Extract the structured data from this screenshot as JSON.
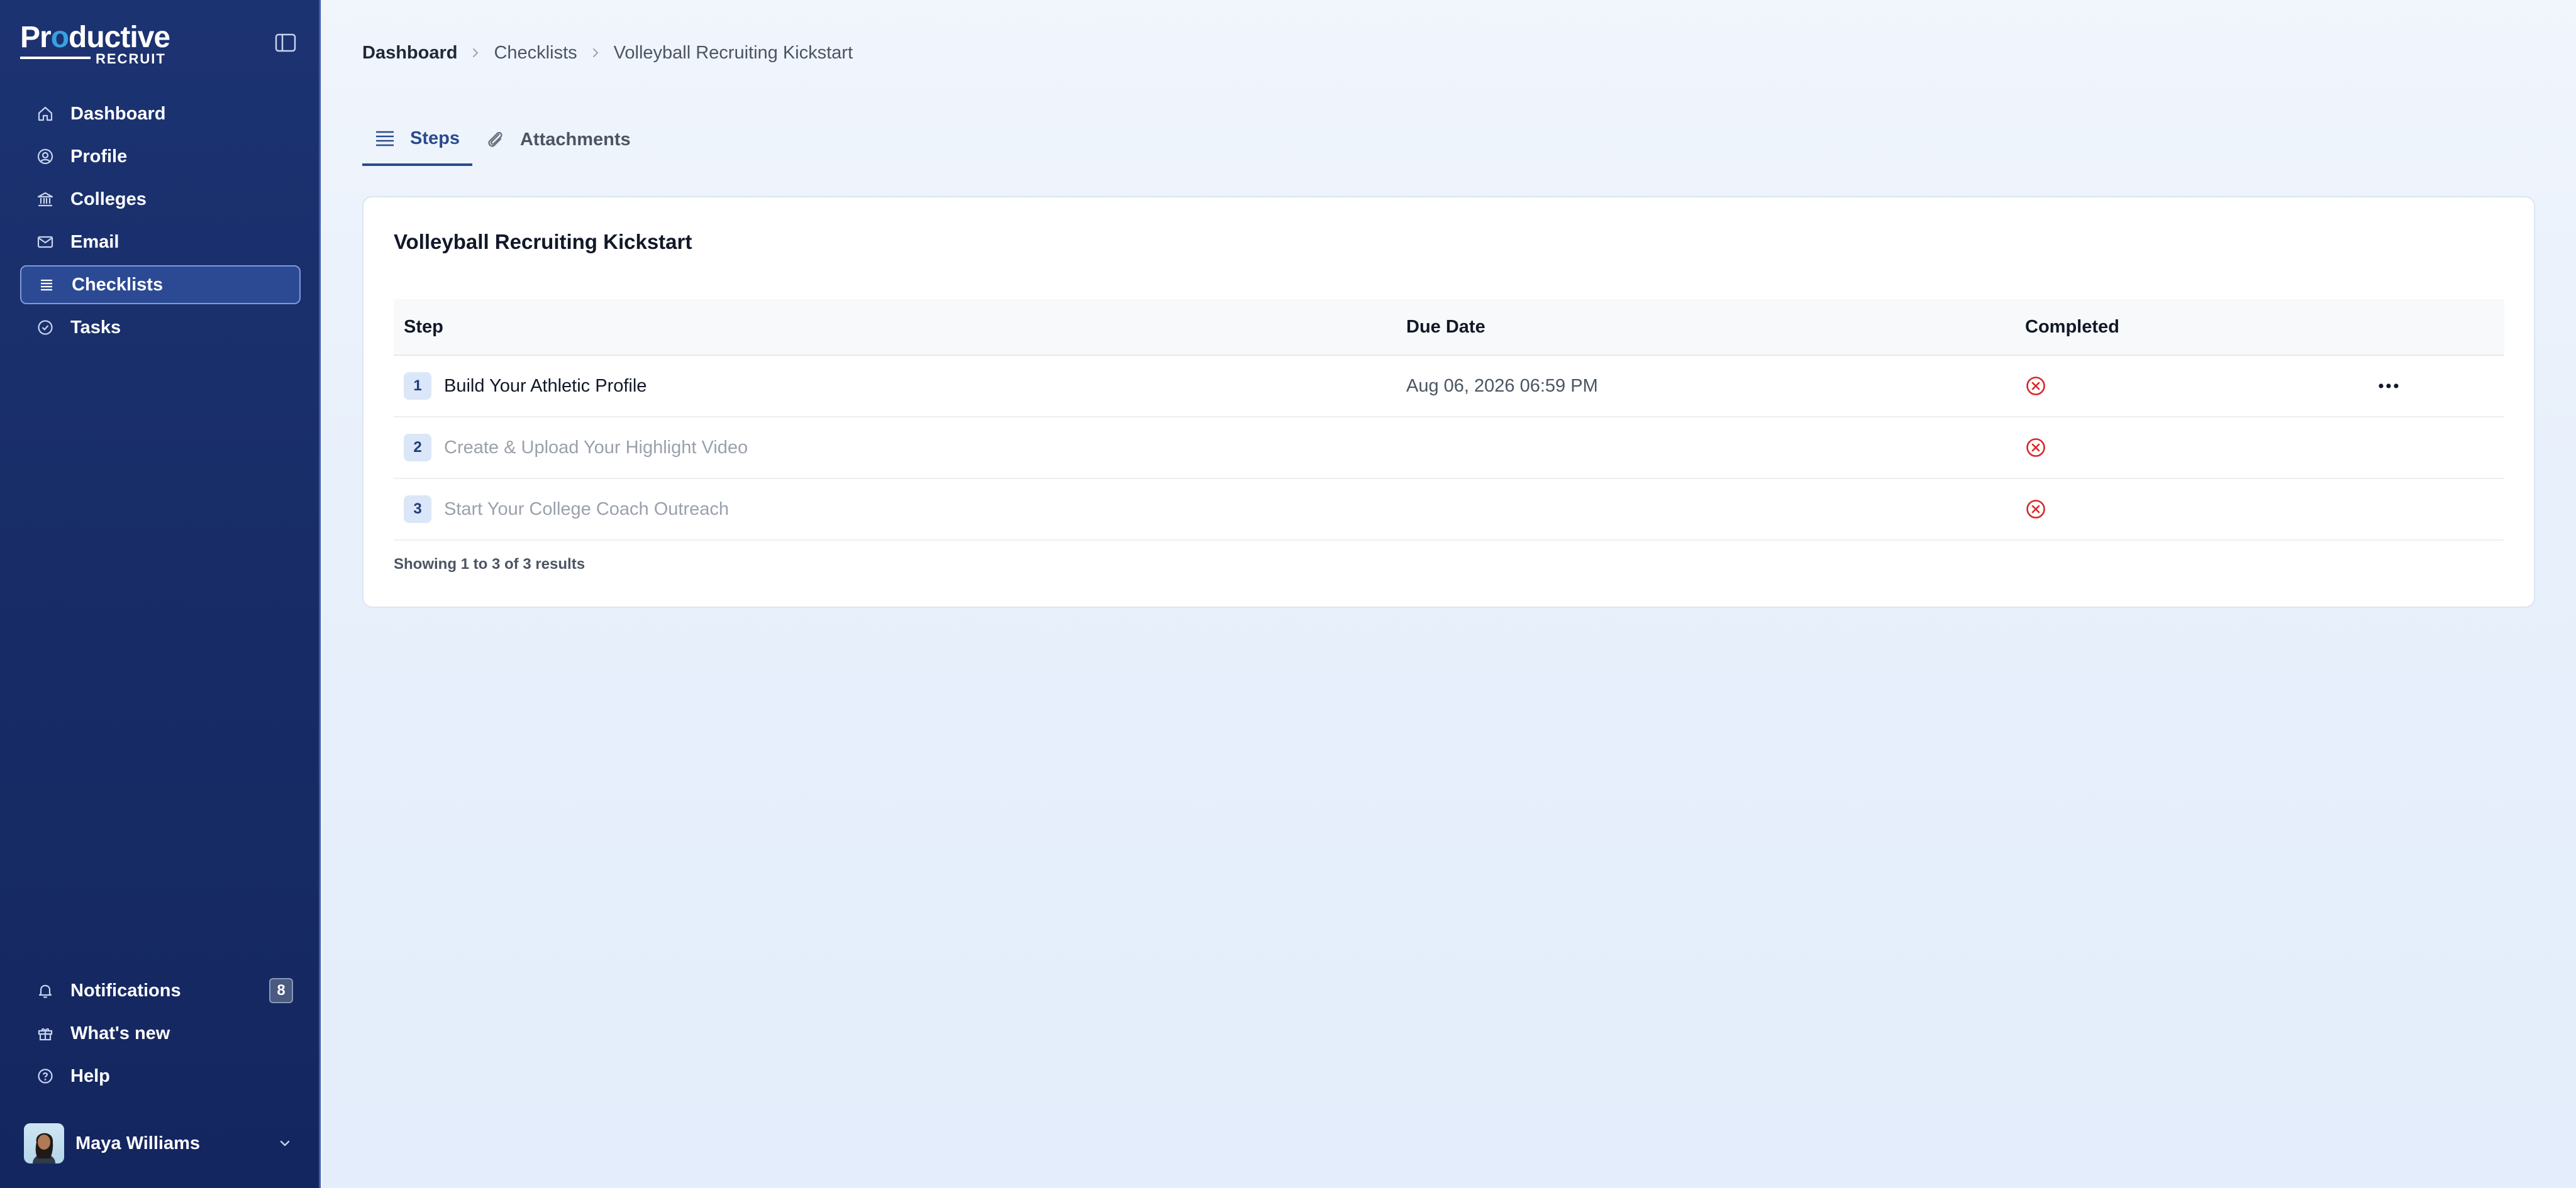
{
  "brand": {
    "top": "Productive",
    "top_prefix": "Pr",
    "top_gear": "o",
    "top_suffix": "ductive",
    "bottom": "RECRUIT"
  },
  "sidebar": {
    "items": [
      {
        "label": "Dashboard",
        "icon": "home-icon",
        "active": false
      },
      {
        "label": "Profile",
        "icon": "user-circle-icon",
        "active": false
      },
      {
        "label": "Colleges",
        "icon": "building-icon",
        "active": false
      },
      {
        "label": "Email",
        "icon": "mail-icon",
        "active": false
      },
      {
        "label": "Checklists",
        "icon": "list-icon",
        "active": true
      },
      {
        "label": "Tasks",
        "icon": "check-circle-icon",
        "active": false
      }
    ],
    "bottom_items": [
      {
        "label": "Notifications",
        "icon": "bell-icon",
        "badge": "8"
      },
      {
        "label": "What's new",
        "icon": "gift-icon"
      },
      {
        "label": "Help",
        "icon": "help-circle-icon"
      }
    ],
    "user": {
      "name": "Maya Williams"
    }
  },
  "breadcrumb": [
    "Dashboard",
    "Checklists",
    "Volleyball Recruiting Kickstart"
  ],
  "tabs": [
    {
      "label": "Steps",
      "icon": "list-icon",
      "active": true
    },
    {
      "label": "Attachments",
      "icon": "paperclip-icon",
      "active": false
    }
  ],
  "card": {
    "title": "Volleyball Recruiting Kickstart",
    "columns": {
      "step": "Step",
      "due": "Due Date",
      "completed": "Completed"
    },
    "rows": [
      {
        "num": "1",
        "name": "Build Your Athletic Profile",
        "due": "Aug 06, 2026 06:59 PM",
        "completed": false,
        "locked": false,
        "has_menu": true
      },
      {
        "num": "2",
        "name": "Create & Upload Your Highlight Video",
        "due": "",
        "completed": false,
        "locked": true,
        "has_menu": false
      },
      {
        "num": "3",
        "name": "Start Your College Coach Outreach",
        "due": "",
        "completed": false,
        "locked": true,
        "has_menu": false
      }
    ],
    "footer": "Showing 1 to 3 of 3 results"
  },
  "colors": {
    "sidebar": "#1c3372",
    "accent": "#2a4a8e",
    "danger": "#dc2626"
  }
}
